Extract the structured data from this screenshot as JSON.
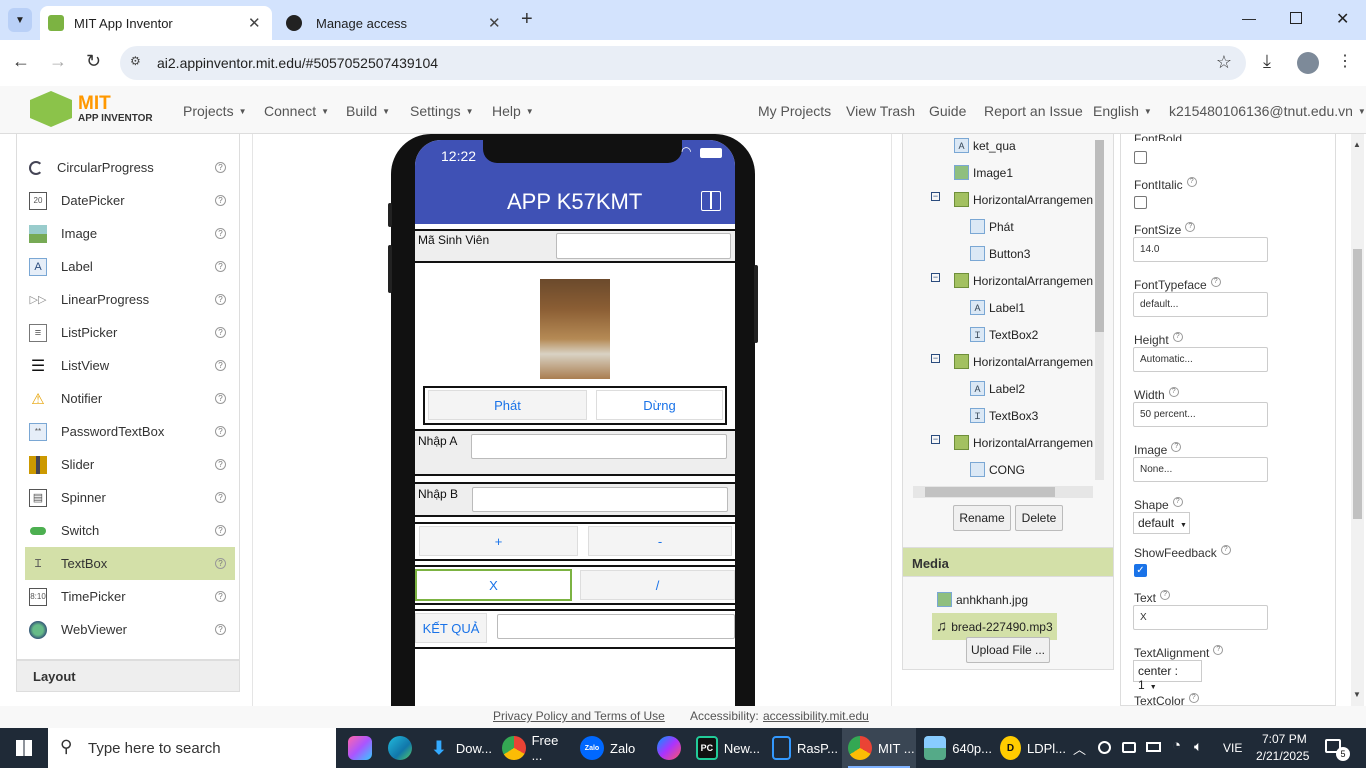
{
  "browser": {
    "tabs": [
      {
        "title": "MIT App Inventor",
        "active": true
      },
      {
        "title": "Manage access",
        "active": false
      }
    ],
    "url": "ai2.appinventor.mit.edu/#5057052507439104",
    "colors": {
      "tabstrip": "#d3e3fd",
      "urlbox": "#e9eef6"
    }
  },
  "header": {
    "logo_line1": "MIT",
    "logo_line2": "APP INVENTOR",
    "menus": [
      "Projects",
      "Connect",
      "Build",
      "Settings",
      "Help"
    ],
    "links": [
      "My Projects",
      "View Trash",
      "Guide",
      "Report an Issue",
      "English"
    ],
    "account": "k215480106136@tnut.edu.vn"
  },
  "palette": {
    "items": [
      {
        "label": "CircularProgress",
        "icon": "circular-progress-icon"
      },
      {
        "label": "DatePicker",
        "icon": "datepicker-icon"
      },
      {
        "label": "Image",
        "icon": "image-icon"
      },
      {
        "label": "Label",
        "icon": "label-icon"
      },
      {
        "label": "LinearProgress",
        "icon": "linear-progress-icon"
      },
      {
        "label": "ListPicker",
        "icon": "listpicker-icon"
      },
      {
        "label": "ListView",
        "icon": "listview-icon"
      },
      {
        "label": "Notifier",
        "icon": "notifier-icon"
      },
      {
        "label": "PasswordTextBox",
        "icon": "password-icon"
      },
      {
        "label": "Slider",
        "icon": "slider-icon"
      },
      {
        "label": "Spinner",
        "icon": "spinner-icon"
      },
      {
        "label": "Switch",
        "icon": "switch-icon"
      },
      {
        "label": "TextBox",
        "icon": "textbox-icon",
        "selected": true
      },
      {
        "label": "TimePicker",
        "icon": "timepicker-icon"
      },
      {
        "label": "WebViewer",
        "icon": "webviewer-icon"
      }
    ],
    "help_mark": "?",
    "section_layout": "Layout"
  },
  "phone": {
    "time": "12:22",
    "title": "APP K57KMT",
    "masv_label": "Mã Sinh Viên",
    "btn_phat": "Phát",
    "btn_dung": "Dừng",
    "nhapa_label": "Nhập A",
    "nhapb_label": "Nhập B",
    "btn_plus": "+",
    "btn_minus": "-",
    "btn_x": "X",
    "btn_div": "/",
    "btn_ketqua": "KẾT QUẢ",
    "theme_color": "#3f51b5"
  },
  "components": {
    "items": [
      "ket_qua",
      "Image1",
      "HorizontalArrangemen",
      "Phát",
      "Button3",
      "HorizontalArrangemen",
      "Label1",
      "TextBox2",
      "HorizontalArrangemen",
      "Label2",
      "TextBox3",
      "HorizontalArrangemen",
      "CONG"
    ],
    "rename": "Rename",
    "delete": "Delete"
  },
  "media": {
    "title": "Media",
    "files": [
      "anhkhanh.jpg",
      "bread-227490.mp3"
    ],
    "upload": "Upload File ..."
  },
  "properties": {
    "fontbold_label": "FontBold",
    "fontitalic_label": "FontItalic",
    "fontsize_label": "FontSize",
    "fontsize_value": "14.0",
    "fonttypeface_label": "FontTypeface",
    "fonttypeface_value": "default...",
    "height_label": "Height",
    "height_value": "Automatic...",
    "width_label": "Width",
    "width_value": "50 percent...",
    "image_label": "Image",
    "image_value": "None...",
    "shape_label": "Shape",
    "shape_value": "default",
    "showfeedback_label": "ShowFeedback",
    "showfeedback_checked": true,
    "text_label": "Text",
    "text_value": "X",
    "textalignment_label": "TextAlignment",
    "textalignment_value": "center : 1",
    "textcolor_label": "TextColor"
  },
  "footer": {
    "privacy": "Privacy Policy and Terms of Use",
    "accessibility_label": "Accessibility:",
    "accessibility_link": "accessibility.mit.edu"
  },
  "taskbar": {
    "search_placeholder": "Type here to search",
    "apps": [
      "Dow...",
      "Free ...",
      "Zalo",
      "New...",
      "RasP...",
      "MIT ...",
      "640p...",
      "LDPl..."
    ],
    "lang": "VIE",
    "time": "7:07 PM",
    "date": "2/21/2025",
    "notif_count": "5"
  }
}
